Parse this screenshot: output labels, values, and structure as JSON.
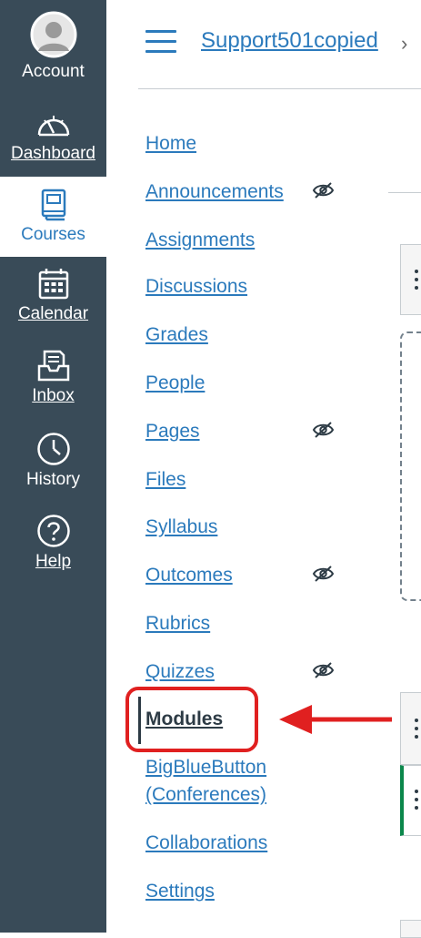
{
  "global_nav": {
    "items": [
      {
        "label": "Account",
        "icon": "avatar-icon"
      },
      {
        "label": "Dashboard",
        "icon": "dashboard-icon"
      },
      {
        "label": "Courses",
        "icon": "courses-icon",
        "active": true
      },
      {
        "label": "Calendar",
        "icon": "calendar-icon"
      },
      {
        "label": "Inbox",
        "icon": "inbox-icon"
      },
      {
        "label": "History",
        "icon": "history-icon"
      },
      {
        "label": "Help",
        "icon": "help-icon"
      }
    ]
  },
  "header": {
    "breadcrumb": "Support501copied",
    "chevron": "›"
  },
  "course_nav": {
    "items": [
      {
        "label": "Home"
      },
      {
        "label": "Announcements",
        "hidden_icon": true
      },
      {
        "label": "Assignments"
      },
      {
        "label": "Discussions"
      },
      {
        "label": "Grades"
      },
      {
        "label": "People"
      },
      {
        "label": "Pages",
        "hidden_icon": true
      },
      {
        "label": "Files"
      },
      {
        "label": "Syllabus"
      },
      {
        "label": "Outcomes",
        "hidden_icon": true
      },
      {
        "label": "Rubrics"
      },
      {
        "label": "Quizzes",
        "hidden_icon": true
      },
      {
        "label": "Modules",
        "active": true
      },
      {
        "label": "BigBlueButton (Conferences)"
      },
      {
        "label": "Collaborations"
      },
      {
        "label": "Settings"
      }
    ],
    "bbb_line1": "BigBlueButton",
    "bbb_line2": "(Conferences)"
  },
  "colors": {
    "global_nav_bg": "#394b58",
    "link": "#2b7abc",
    "annotation": "#e02020",
    "module_accent": "#0b874b"
  }
}
